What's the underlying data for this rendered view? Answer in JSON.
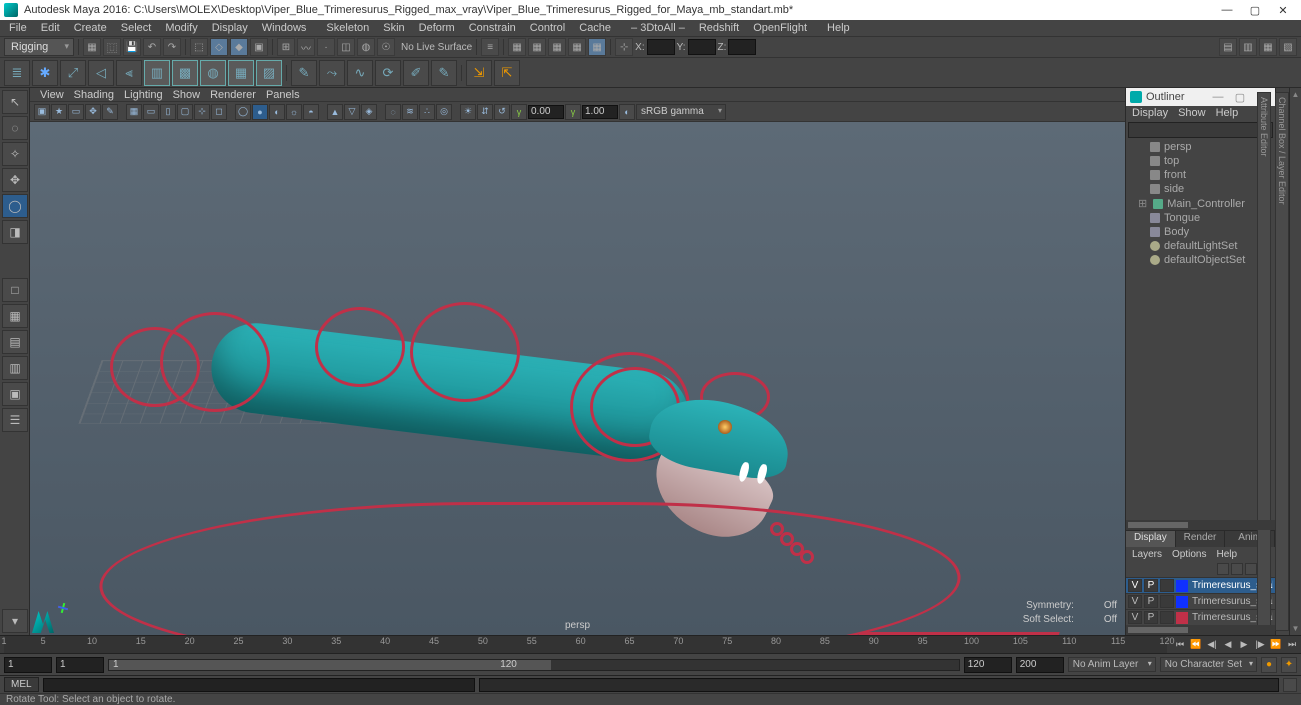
{
  "title": "Autodesk Maya 2016: C:\\Users\\MOLEX\\Desktop\\Viper_Blue_Trimeresurus_Rigged_max_vray\\Viper_Blue_Trimeresurus_Rigged_for_Maya_mb_standart.mb*",
  "menubar": [
    "File",
    "Edit",
    "Create",
    "Select",
    "Modify",
    "Display",
    "Windows",
    "Skeleton",
    "Skin",
    "Deform",
    "Constrain",
    "Control",
    "Cache",
    "– 3DtoAll –",
    "Redshift",
    "OpenFlight",
    "Help"
  ],
  "module_dropdown": "Rigging",
  "status": {
    "surface": "No Live Surface",
    "xl": "X:",
    "yl": "Y:",
    "zl": "Z:",
    "x": "",
    "y": "",
    "z": ""
  },
  "viewport_menubar": [
    "View",
    "Shading",
    "Lighting",
    "Show",
    "Renderer",
    "Panels"
  ],
  "vp_gamma_lo": "0.00",
  "vp_gamma_hi": "1.00",
  "vp_colorspace": "sRGB gamma",
  "camera": "persp",
  "vp_overlay": {
    "sym_l": "Symmetry:",
    "sym_v": "Off",
    "ss_l": "Soft Select:",
    "ss_v": "Off"
  },
  "right_tabs": [
    "Channel Box / Layer Editor",
    "Attribute Editor"
  ],
  "outliner": {
    "title": "Outliner",
    "menu": [
      "Display",
      "Show",
      "Help"
    ],
    "nodes": [
      {
        "name": "persp",
        "icon": "cam"
      },
      {
        "name": "top",
        "icon": "cam"
      },
      {
        "name": "front",
        "icon": "cam"
      },
      {
        "name": "side",
        "icon": "cam"
      },
      {
        "name": "Main_Controller",
        "icon": "ctrl",
        "exp": true
      },
      {
        "name": "Tongue",
        "icon": "mesh"
      },
      {
        "name": "Body",
        "icon": "mesh"
      },
      {
        "name": "defaultLightSet",
        "icon": "set"
      },
      {
        "name": "defaultObjectSet",
        "icon": "set"
      }
    ]
  },
  "lower_tabs": [
    "Display",
    "Render",
    "Anim"
  ],
  "lower_menu": [
    "Layers",
    "Options",
    "Help"
  ],
  "layers": [
    {
      "v": "V",
      "p": "P",
      "color": "#1030ff",
      "name": "Trimeresurus_snake",
      "sel": true
    },
    {
      "v": "V",
      "p": "P",
      "color": "#1030ff",
      "name": "Trimeresurus_snake_bo"
    },
    {
      "v": "V",
      "p": "P",
      "color": "#c03048",
      "name": "Trimeresurus_snake_co"
    }
  ],
  "timeline_ticks": [
    1,
    5,
    10,
    15,
    20,
    25,
    30,
    35,
    40,
    45,
    50,
    55,
    60,
    65,
    70,
    75,
    80,
    85,
    90,
    95,
    100,
    105,
    110,
    115,
    120
  ],
  "range": {
    "start_outer": "1",
    "start_inner": "1",
    "cur": "1",
    "end_inner": "120",
    "end_outer": "200",
    "anim_layer": "No Anim Layer",
    "char_set": "No Character Set"
  },
  "cmd": {
    "lang": "MEL"
  },
  "helpline": "Rotate Tool: Select an object to rotate."
}
